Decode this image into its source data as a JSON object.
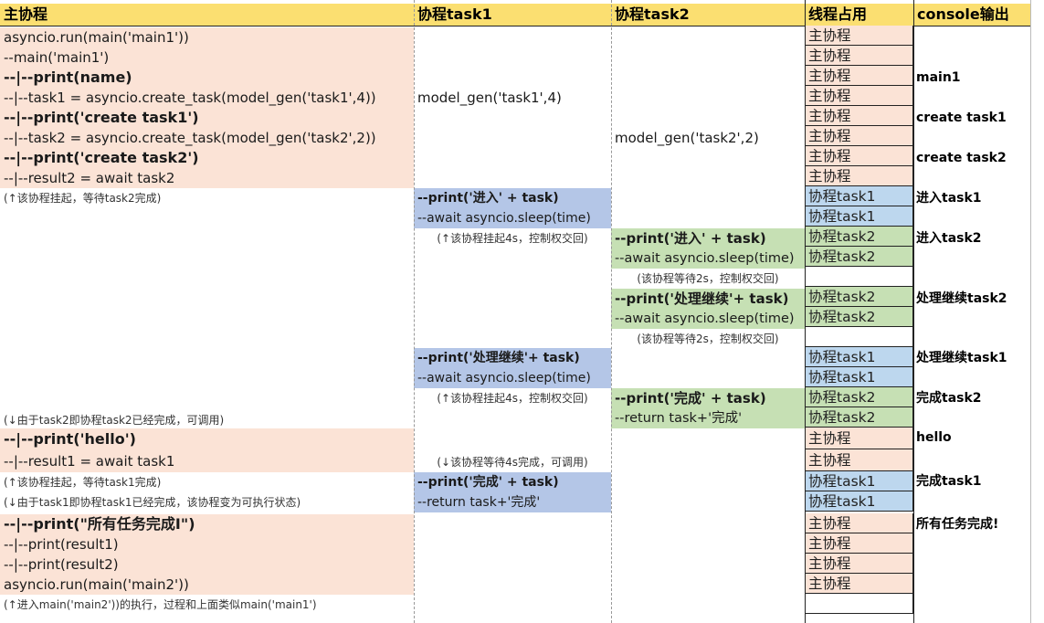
{
  "header": {
    "main": "主协程",
    "task1": "协程task1",
    "task2": "协程task2",
    "thread": "线程占用",
    "console": "console输出"
  },
  "main_col": {
    "run1": "asyncio.run(main('main1'))",
    "main1": "--main('main1')",
    "print_name": "--|--print(name)",
    "create_task1": "--|--task1 = asyncio.create_task(model_gen('task1',4))",
    "print_ct1": "--|--print('create task1')",
    "create_task2": "--|--task2 = asyncio.create_task(model_gen('task2',2))",
    "print_ct2": "--|--print('create task2')",
    "await_t2": "--|--result2 = await task2",
    "note_suspend_t2": "(↑该协程挂起，等待task2完成)",
    "note_t2_done": "(↓由于task2即协程task2已经完成，可调用)",
    "print_hello": "--|--print('hello')",
    "await_t1": "--|--result1 = await task1",
    "note_suspend_t1": "(↑该协程挂起，等待task1完成)",
    "note_t1_done": "(↓由于task1即协程task1已经完成，该协程变为可执行状态)",
    "print_all_done": "--|--print(\"所有任务完成Ⅰ\")",
    "print_r1": "--|--print(result1)",
    "print_r2": "--|--print(result2)",
    "run2": "asyncio.run(main('main2'))",
    "note_main2": "(↑进入main('main2'))的执行，过程和上面类似main('main1')"
  },
  "task1_col": {
    "model_gen": "model_gen('task1',4)",
    "print_enter": "--print('进入' + task)",
    "sleep1": "--await asyncio.sleep(time)",
    "note_sleep1": "(↑该协程挂起4s，控制权交回)",
    "print_continue": "--print('处理继续'+ task)",
    "sleep2": "--await asyncio.sleep(time)",
    "note_sleep2": "(↑该协程挂起4s，控制权交回)",
    "note_wait_done": "(↓该协程等待4s完成，可调用)",
    "print_done": "--print('完成' + task)",
    "return": "--return task+'完成'"
  },
  "task2_col": {
    "model_gen": "model_gen('task2',2)",
    "print_enter": "--print('进入' + task)",
    "sleep1": "--await asyncio.sleep(time)",
    "note_sleep1": "(该协程等待2s，控制权交回)",
    "print_continue": "--print('处理继续'+ task)",
    "sleep2": "--await asyncio.sleep(time)",
    "note_sleep2": "(该协程等待2s，控制权交回)",
    "print_done": "--print('完成' + task)",
    "return": "--return task+'完成'"
  },
  "thread_col": {
    "r1": "主协程",
    "r2": "主协程",
    "r3": "主协程",
    "r4": "主协程",
    "r5": "主协程",
    "r6": "主协程",
    "r7": "主协程",
    "r8": "主协程",
    "r9": "协程task1",
    "r10": "协程task1",
    "r11": "协程task2",
    "r12": "协程task2",
    "r13": "协程task2",
    "r14": "协程task2",
    "r15": "协程task1",
    "r16": "协程task1",
    "r17": "协程task2",
    "r18": "协程task2",
    "r19": "主协程",
    "r20": "主协程",
    "r21": "协程task1",
    "r22": "协程task1",
    "r23": "主协程",
    "r24": "主协程",
    "r25": "主协程",
    "r26": "主协程"
  },
  "console_col": {
    "main1": "main1",
    "create_task1": "create task1",
    "create_task2": "create task2",
    "enter_task1": "进入task1",
    "enter_task2": "进入task2",
    "continue_task2": "处理继续task2",
    "continue_task1": "处理继续task1",
    "done_task2": "完成task2",
    "hello": "hello",
    "done_task1": "完成task1",
    "all_done": "所有任务完成!"
  },
  "colors": {
    "header": "#fbdf71",
    "main_thread": "#fbe3d6",
    "task1": "#b4c6e7",
    "task2": "#c6e0b4",
    "task1_thread": "#bdd7ee"
  }
}
